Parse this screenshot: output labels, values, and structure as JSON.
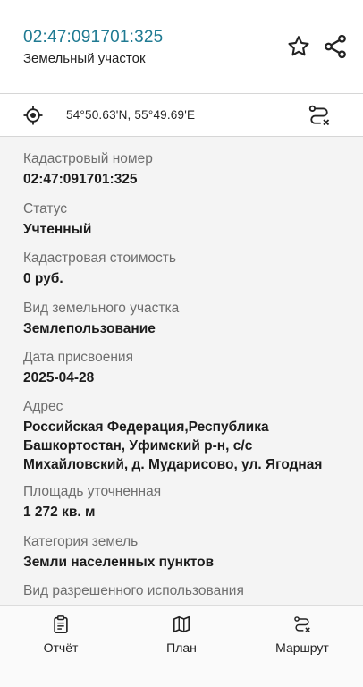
{
  "header": {
    "title": "02:47:091701:325",
    "subtitle": "Земельный участок"
  },
  "location": {
    "coords": "54°50.63'N, 55°49.69'E"
  },
  "fields": [
    {
      "label": "Кадастровый номер",
      "value": "02:47:091701:325"
    },
    {
      "label": "Статус",
      "value": "Учтенный"
    },
    {
      "label": "Кадастровая стоимость",
      "value": "0 руб."
    },
    {
      "label": "Вид земельного участка",
      "value": "Землепользование"
    },
    {
      "label": "Дата присвоения",
      "value": "2025-04-28"
    },
    {
      "label": "Адрес",
      "value": "Российская Федерация,Республика Башкортостан, Уфимский р-н, с/с Михайловский, д. Мударисово, ул. Ягодная"
    },
    {
      "label": "Площадь уточненная",
      "value": "1 272 кв. м"
    },
    {
      "label": "Категория земель",
      "value": "Земли населенных пунктов"
    },
    {
      "label": "Вид разрешенного использования",
      "value": ""
    }
  ],
  "tabs": {
    "report": "Отчёт",
    "plan": "План",
    "route": "Маршрут"
  },
  "colors": {
    "accent": "#1f7a92",
    "content_bg": "#f4f4f4"
  }
}
